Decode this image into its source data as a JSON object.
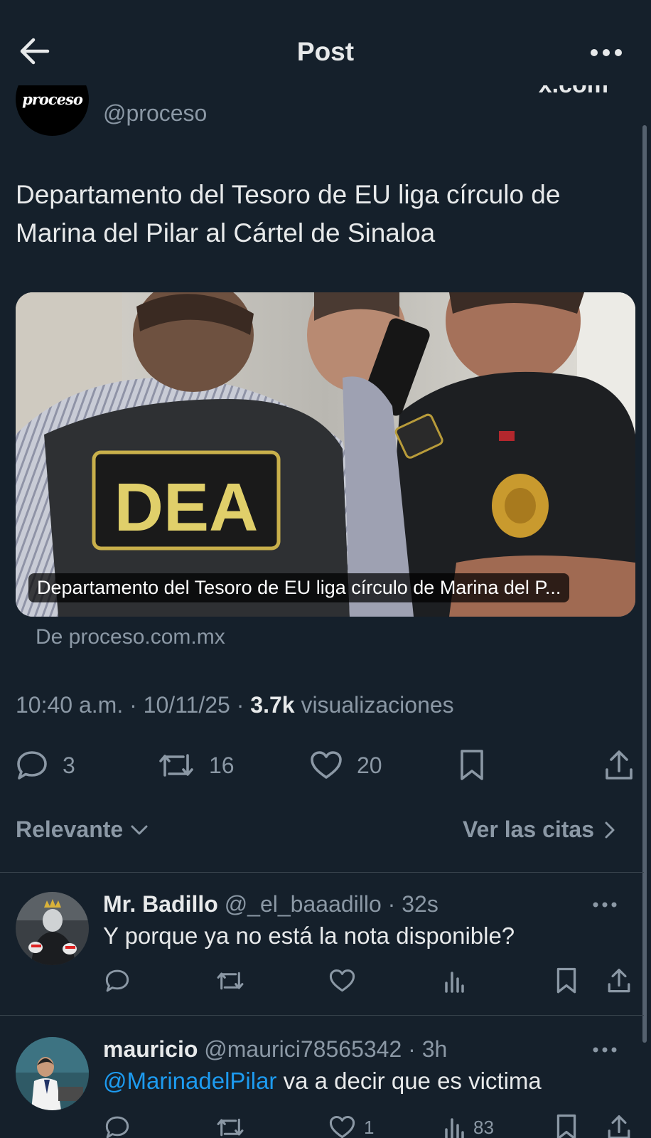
{
  "header": {
    "title": "Post"
  },
  "post": {
    "author_handle": "@proceso",
    "avatar_logo_text": "proceso",
    "source_fragment": "x.com",
    "text": "Departamento del Tesoro de EU liga círculo de Marina del Pilar al Cártel de Sinaloa",
    "card": {
      "image_patch_text": "DEA",
      "caption": "Departamento del Tesoro de EU liga círculo de Marina del P...",
      "source": "De proceso.com.mx"
    },
    "meta": {
      "time": "10:40 a.m.",
      "sep1": " · ",
      "date": "10/11/25",
      "sep2": " · ",
      "views": "3.7k",
      "views_label": " visualizaciones"
    },
    "stats": {
      "replies": "3",
      "reposts": "16",
      "likes": "20"
    }
  },
  "sort": {
    "relevant_label": "Relevante",
    "quotes_label": "Ver las citas"
  },
  "replies": [
    {
      "name": "Mr. Badillo",
      "handle": "@_el_baaadillo",
      "sep": " · ",
      "time": "32s",
      "text": "Y porque ya no está la nota disponible?"
    },
    {
      "name": "mauricio",
      "handle": "@maurici78565342",
      "sep": " · ",
      "time": "3h",
      "mention": "@MarinadelPilar",
      "text": " va a decir que es victima",
      "likes": "1",
      "views": "83"
    }
  ],
  "colors": {
    "background": "#15202b",
    "text": "#e7e9ea",
    "muted": "#8b98a5",
    "accent": "#1d9bf0",
    "divider": "#38444d"
  },
  "icons": [
    "arrow-left-icon",
    "more-icon",
    "reply-icon",
    "repost-icon",
    "heart-icon",
    "bookmark-icon",
    "share-icon",
    "views-icon",
    "chevron-down-icon",
    "chevron-right-icon"
  ]
}
